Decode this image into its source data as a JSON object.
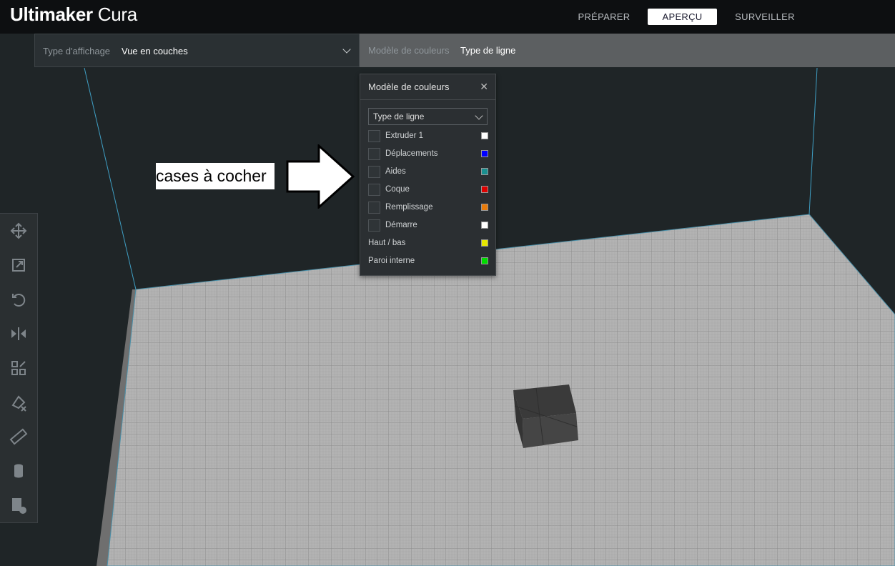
{
  "app": {
    "brand_bold": "Ultimaker",
    "brand_light": "Cura"
  },
  "stages": [
    {
      "label": "PRÉPARER",
      "active": false
    },
    {
      "label": "APERÇU",
      "active": true
    },
    {
      "label": "SURVEILLER",
      "active": false
    }
  ],
  "viewbar": {
    "view_type_label": "Type d'affichage",
    "view_type_value": "Vue en couches",
    "color_scheme_label": "Modèle de couleurs",
    "color_scheme_value": "Type de ligne"
  },
  "panel": {
    "title": "Modèle de couleurs",
    "close_icon": "close-icon",
    "select_value": "Type de ligne",
    "checkbox_items": [
      {
        "label": "Extruder 1",
        "color": "#ffffff"
      },
      {
        "label": "Déplacements",
        "color": "#0000ff"
      },
      {
        "label": "Aides",
        "color": "#1a8f8f"
      },
      {
        "label": "Coque",
        "color": "#dd0000"
      },
      {
        "label": "Remplissage",
        "color": "#e87b0b"
      },
      {
        "label": "Démarre",
        "color": "#ffffff"
      }
    ],
    "plain_items": [
      {
        "label": "Haut / bas",
        "color": "#e6e600"
      },
      {
        "label": "Paroi interne",
        "color": "#00dd00"
      }
    ]
  },
  "annotation": {
    "text": "cases à cocher"
  },
  "toolbar": {
    "tools": [
      "move-icon",
      "scale-icon",
      "rotate-icon",
      "mirror-icon",
      "arrange-icon",
      "support-blocker-icon",
      "measure-icon",
      "cylinder-icon",
      "per-model-settings-icon"
    ]
  }
}
